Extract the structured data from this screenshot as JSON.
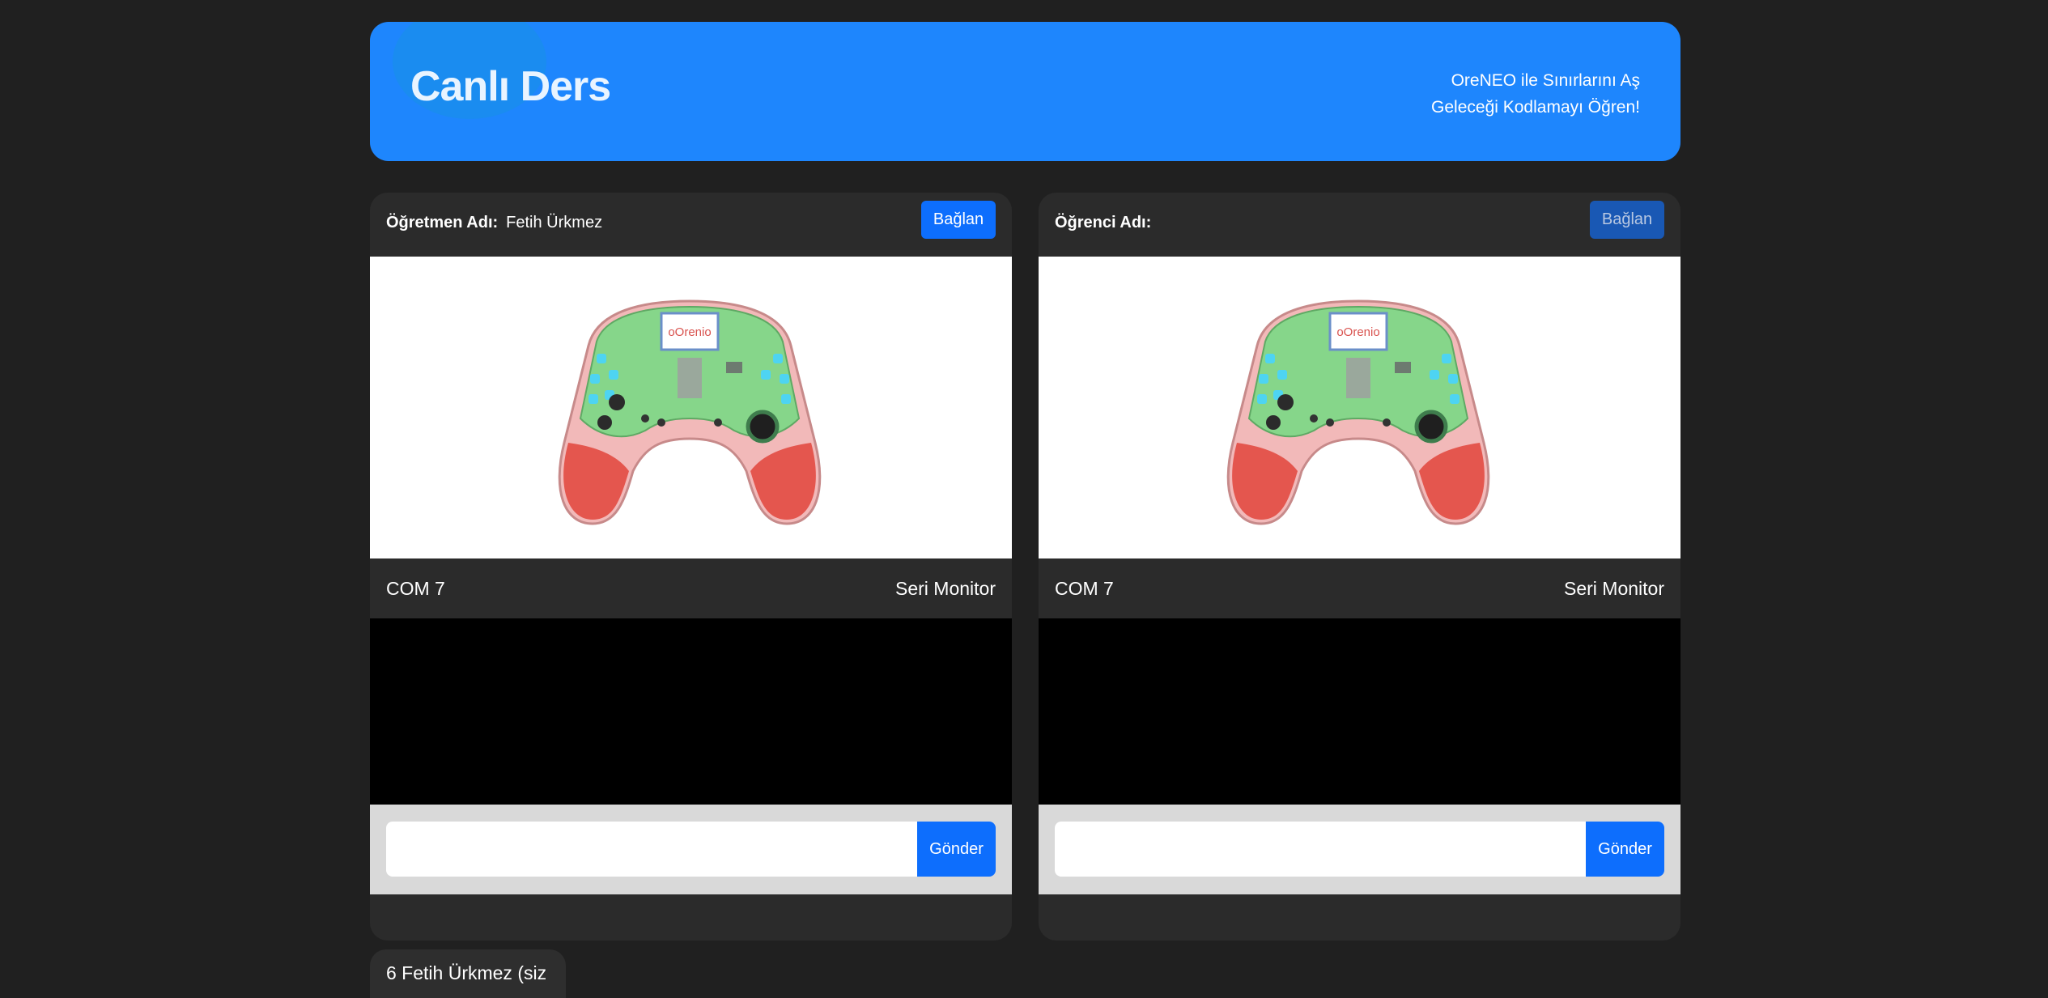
{
  "header": {
    "title": "Canlı Ders",
    "tagline_line1": "OreNEO ile Sınırlarını Aş",
    "tagline_line2": "Geleceği Kodlamayı Öğren!"
  },
  "teacher_panel": {
    "label": "Öğretmen Adı:",
    "name": "Fetih Ürkmez",
    "connect_label": "Bağlan",
    "port": "COM 7",
    "monitor_label": "Seri Monitor",
    "input_value": "",
    "send_label": "Gönder"
  },
  "student_panel": {
    "label": "Öğrenci Adı:",
    "name": "",
    "connect_label": "Bağlan",
    "port": "COM 7",
    "monitor_label": "Seri Monitor",
    "input_value": "",
    "send_label": "Gönder"
  },
  "participants": {
    "visible_text": "6 Fetih Ürkmez (siz"
  },
  "colors": {
    "page_bg": "#202020",
    "header_bg": "#1e86fd",
    "panel_bg": "#2b2b2b",
    "button_primary": "#0d6efd",
    "button_disabled": "#1958b4"
  },
  "icons": {
    "device_image": "controller-board-image"
  }
}
